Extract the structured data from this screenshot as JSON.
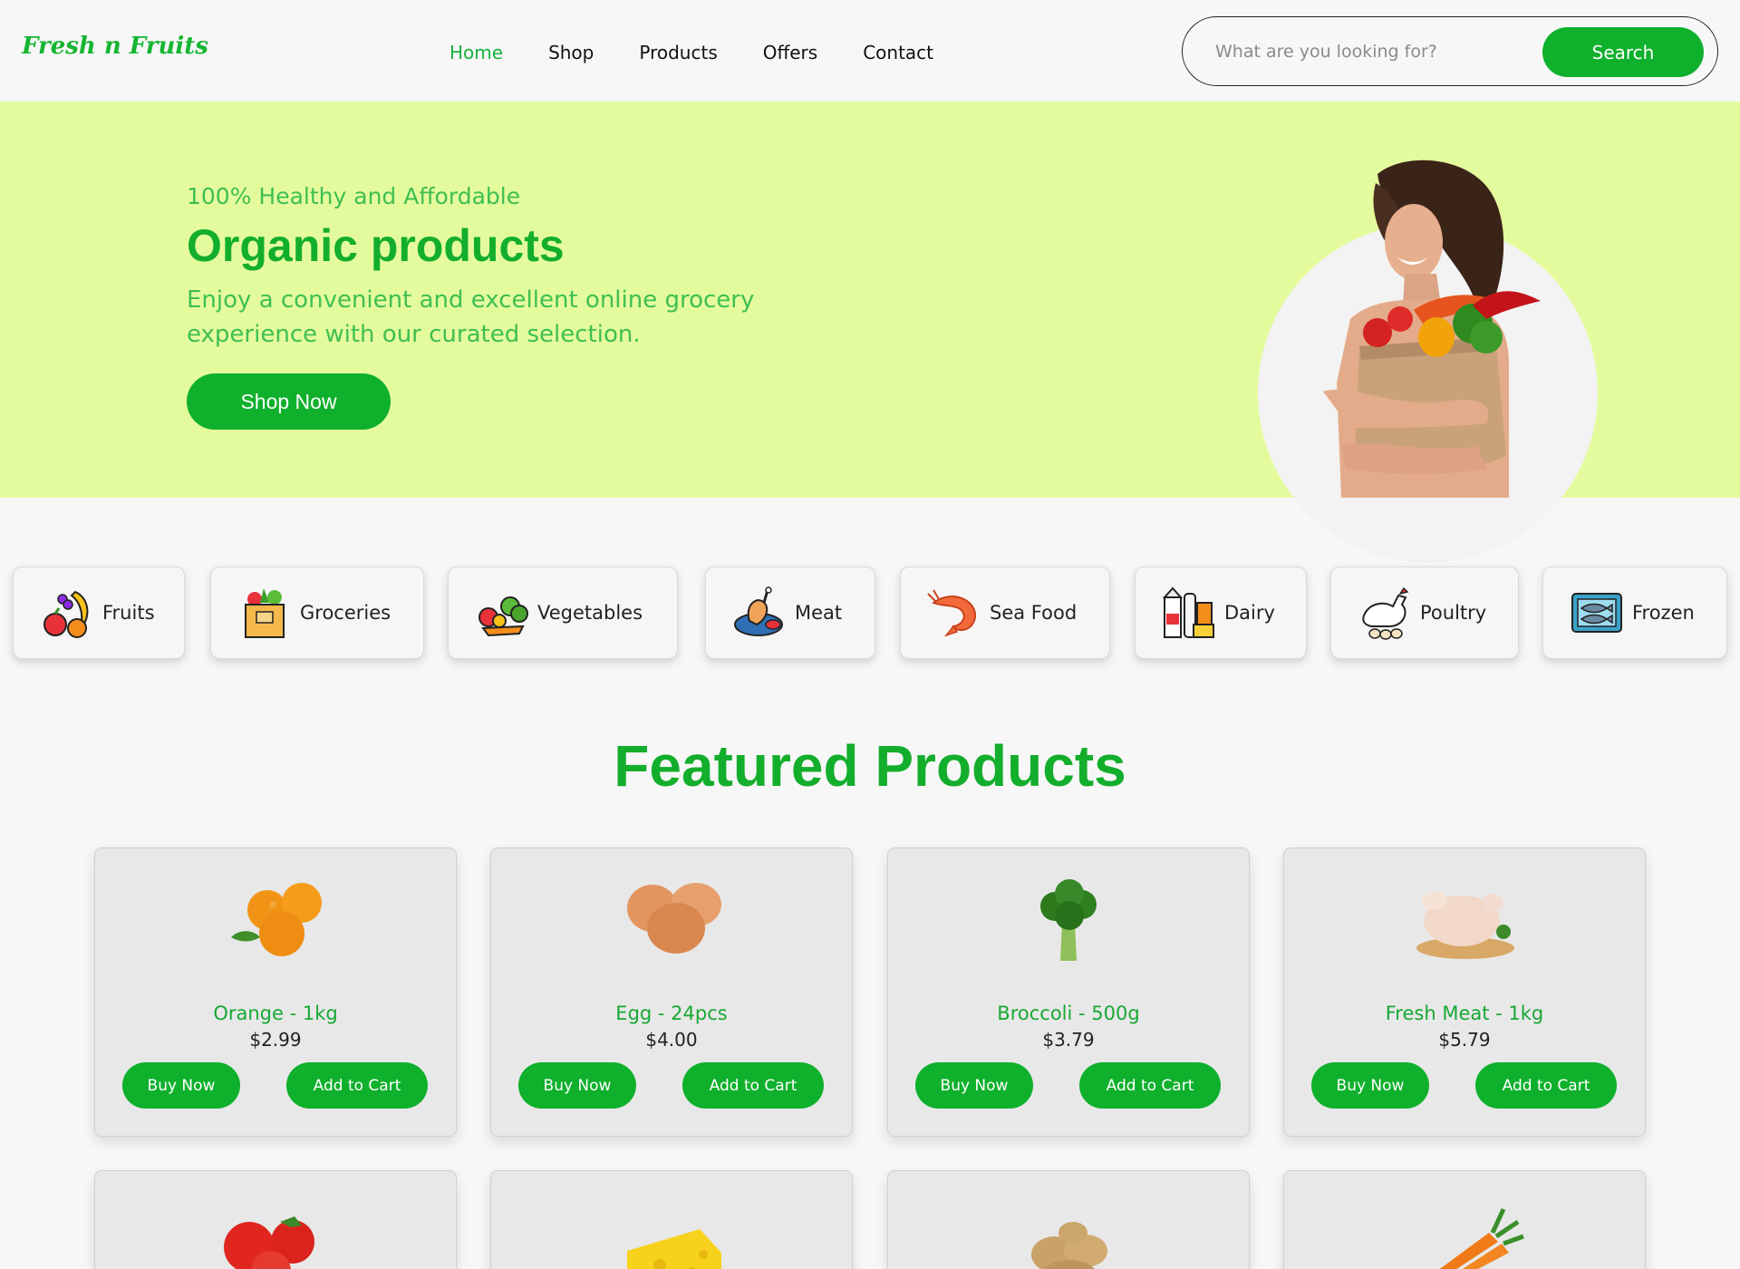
{
  "header": {
    "logo": "Fresh n Fruits",
    "nav": [
      "Home",
      "Shop",
      "Products",
      "Offers",
      "Contact"
    ],
    "active_nav": "Home",
    "search_placeholder": "What are you looking for?",
    "search_button": "Search"
  },
  "hero": {
    "kicker": "100% Healthy and Affordable",
    "title": "Organic products",
    "text": "Enjoy a convenient and excellent online grocery experience with our curated selection.",
    "button": "Shop Now"
  },
  "categories": [
    {
      "label": "Fruits",
      "icon": "fruits-icon"
    },
    {
      "label": "Groceries",
      "icon": "groceries-icon"
    },
    {
      "label": "Vegetables",
      "icon": "vegetables-icon"
    },
    {
      "label": "Meat",
      "icon": "meat-icon"
    },
    {
      "label": "Sea Food",
      "icon": "seafood-icon"
    },
    {
      "label": "Dairy",
      "icon": "dairy-icon"
    },
    {
      "label": "Poultry",
      "icon": "poultry-icon"
    },
    {
      "label": "Frozen",
      "icon": "frozen-icon"
    }
  ],
  "featured": {
    "title": "Featured Products",
    "buy_label": "Buy Now",
    "cart_label": "Add to Cart",
    "products": [
      {
        "name": "Orange - 1kg",
        "price": "$2.99",
        "image": "orange-image"
      },
      {
        "name": "Egg - 24pcs",
        "price": "$4.00",
        "image": "egg-image"
      },
      {
        "name": "Broccoli - 500g",
        "price": "$3.79",
        "image": "broccoli-image"
      },
      {
        "name": "Fresh Meat - 1kg",
        "price": "$5.79",
        "image": "chicken-image"
      }
    ],
    "more_products": [
      {
        "image": "tomato-image"
      },
      {
        "image": "cheese-image"
      },
      {
        "image": "potato-image"
      },
      {
        "image": "carrot-image"
      }
    ]
  },
  "colors": {
    "brand_green": "#0fb02c",
    "hero_background": "#e4fb9d",
    "page_background": "#f7f7f7"
  }
}
